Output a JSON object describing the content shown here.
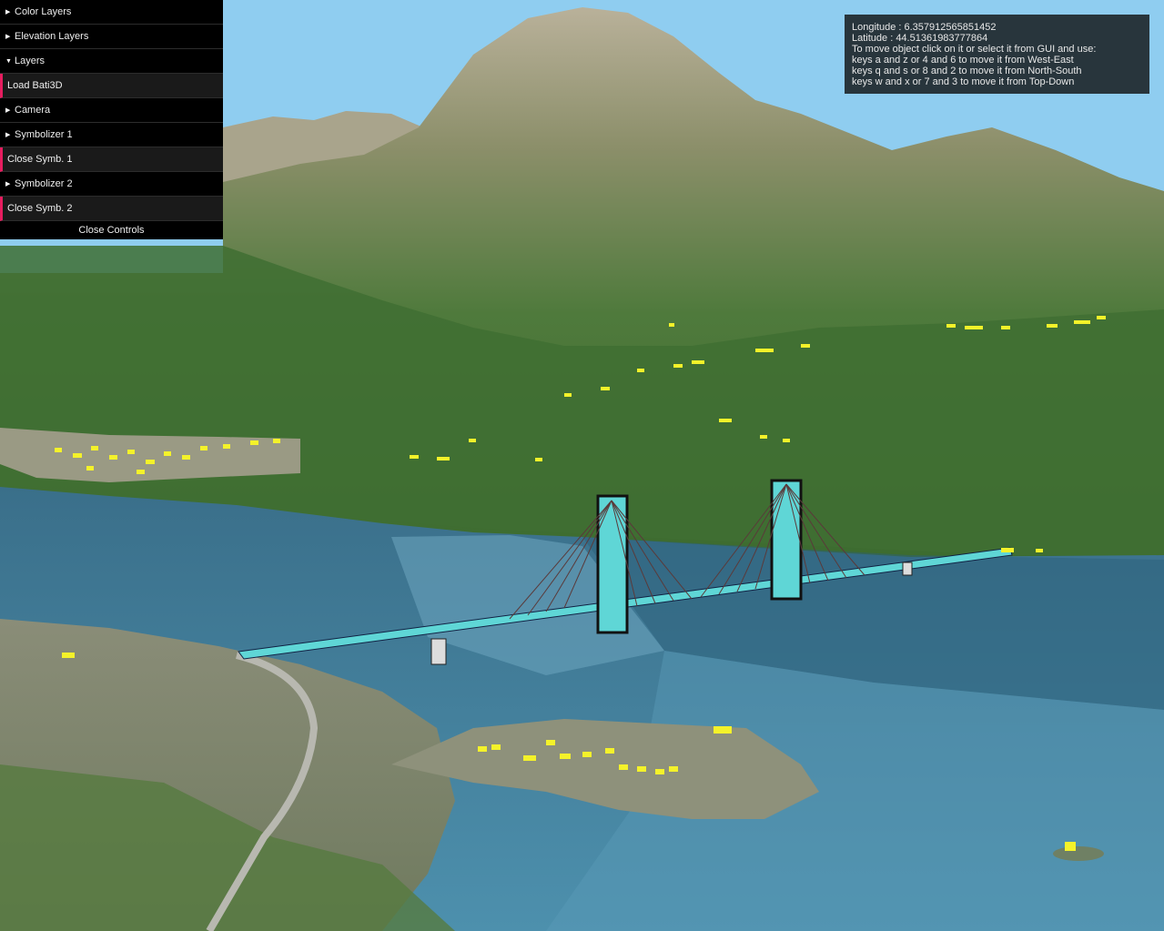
{
  "gui": {
    "items": [
      {
        "type": "folder",
        "label": "Color Layers",
        "open": false
      },
      {
        "type": "folder",
        "label": "Elevation Layers",
        "open": false
      },
      {
        "type": "folder",
        "label": "Layers",
        "open": true
      },
      {
        "type": "function",
        "label": "Load Bati3D"
      },
      {
        "type": "folder",
        "label": "Camera",
        "open": false
      },
      {
        "type": "folder",
        "label": "Symbolizer 1",
        "open": false
      },
      {
        "type": "function",
        "label": "Close Symb. 1"
      },
      {
        "type": "folder",
        "label": "Symbolizer 2",
        "open": false
      },
      {
        "type": "function",
        "label": "Close Symb. 2"
      }
    ],
    "close_label": "Close Controls",
    "accent_color": "#e61d5f"
  },
  "info": {
    "longitude": "Longitude : 6.357912565851452",
    "latitude": "Latitude : 44.51361983777864",
    "lines": [
      "To move object click on it or select it from GUI and use:",
      "keys a and z or 4 and 6 to move it from West-East",
      "keys q and s or 8 and 2 to move it from North-South",
      "keys w and x or 7 and 3 to move it from Top-Down"
    ]
  },
  "scene": {
    "sky_color": "#8fcdf0",
    "lake_color": "#3f7f9e",
    "bridge_color": "#5fd6d6",
    "building_color": "#f4f22a"
  }
}
